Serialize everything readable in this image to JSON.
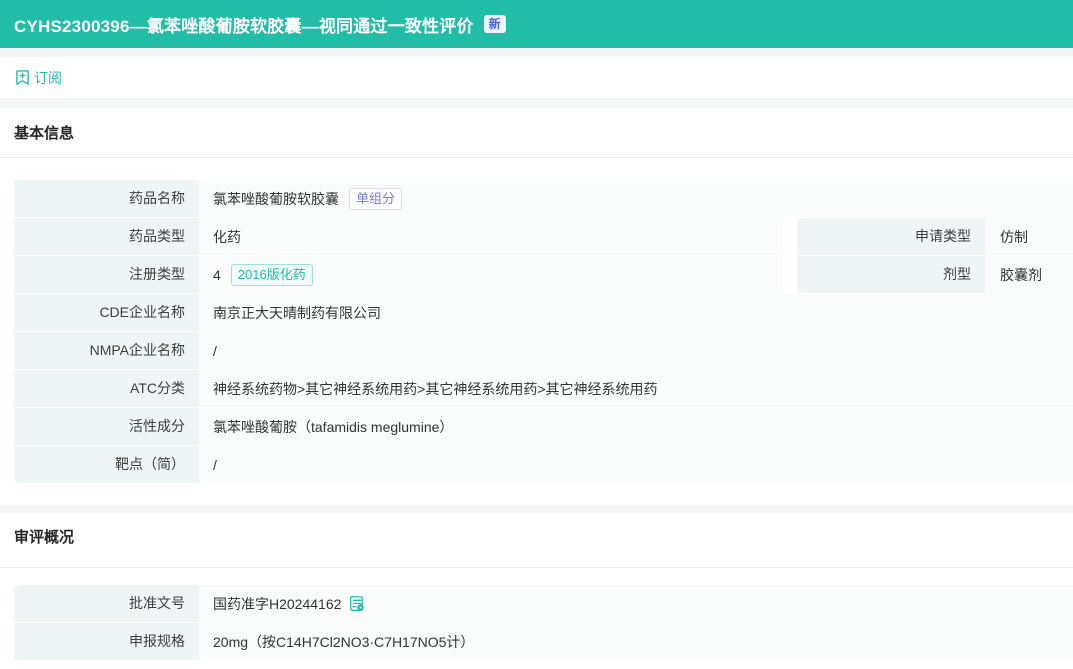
{
  "header": {
    "title": "CYHS2300396—氯苯唑酸葡胺软胶囊—视同通过一致性评价",
    "badge": "新"
  },
  "subscribe": {
    "label": "订阅",
    "icon": "bookmark-plus-icon"
  },
  "sections": {
    "basic_info": {
      "title": "基本信息",
      "rows_left": [
        {
          "label": "药品名称",
          "value": "氯苯唑酸葡胺软胶囊",
          "tag": "单组分",
          "tag_style": "purple"
        },
        {
          "label": "药品类型",
          "value": "化药"
        },
        {
          "label": "注册类型",
          "value": "4",
          "tag": "2016版化药",
          "tag_style": "teal"
        },
        {
          "label": "CDE企业名称",
          "value": "南京正大天晴制药有限公司"
        },
        {
          "label": "NMPA企业名称",
          "value": "/"
        },
        {
          "label": "ATC分类",
          "value": "神经系统药物>其它神经系统用药>其它神经系统用药>其它神经系统用药"
        },
        {
          "label": "活性成分",
          "value": "氯苯唑酸葡胺（tafamidis meglumine）"
        },
        {
          "label": "靶点（简）",
          "value": "/"
        }
      ],
      "rows_right": [
        {
          "label": "申请类型",
          "value": "仿制"
        },
        {
          "label": "剂型",
          "value": "胶囊剂"
        }
      ]
    },
    "review": {
      "title": "审评概况",
      "rows": [
        {
          "label": "批准文号",
          "value": "国药准字H20244162",
          "icon": "document-view-icon"
        },
        {
          "label": "申报规格",
          "value": "20mg（按C14H7Cl2NO3·C7H17NO5计）"
        }
      ]
    }
  },
  "colors": {
    "accent_teal": "#21bda6",
    "page_background": "#f3f5f6",
    "label_cell_background": "#eef5f4",
    "row_background": "#fafcfb",
    "badge_text": "#4668e5",
    "badge_background": "#eef4ff",
    "tag_purple_text": "#777cd0",
    "tag_teal_text": "#1fbca4"
  }
}
